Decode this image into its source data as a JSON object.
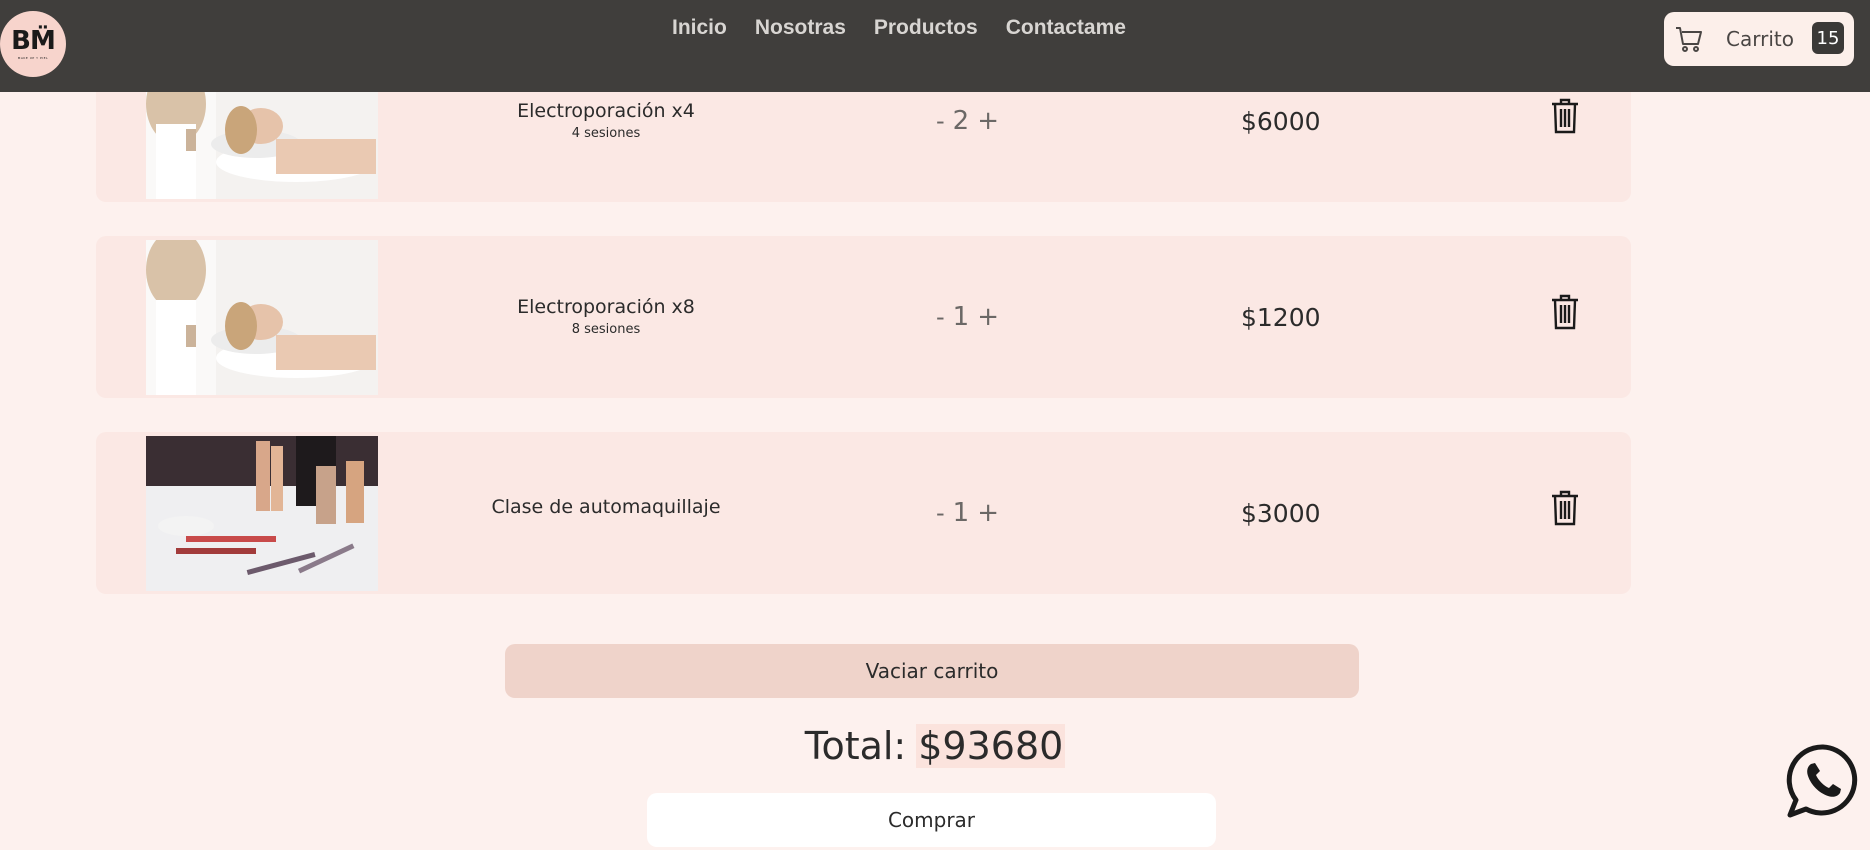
{
  "navbar": {
    "logo": {
      "mark": "BM̈",
      "sub": "MAKE UP Y PIEL"
    },
    "links": [
      "Inicio",
      "Nosotras",
      "Productos",
      "Contactame"
    ],
    "cart": {
      "label": "Carrito",
      "count": "15",
      "icon": "cart-icon"
    }
  },
  "cart": {
    "items": [
      {
        "name": "Electroporación x4",
        "subtitle": "4 sesiones",
        "qty_minus": "-",
        "quantity": "2",
        "qty_plus": "+",
        "price": "$6000",
        "image": "spa-treatment-photo"
      },
      {
        "name": "Electroporación x8",
        "subtitle": "8 sesiones",
        "qty_minus": "-",
        "quantity": "1",
        "qty_plus": "+",
        "price": "$1200",
        "image": "spa-treatment-photo"
      },
      {
        "name": "Clase de automaquillaje",
        "subtitle": "",
        "qty_minus": "-",
        "quantity": "1",
        "qty_plus": "+",
        "price": "$3000",
        "image": "makeup-products-photo"
      }
    ],
    "delete_icon": "trash-icon"
  },
  "actions": {
    "clear_label": "Vaciar carrito",
    "total_label": "Total:",
    "total_value": "$93680",
    "buy_label": "Comprar"
  },
  "floating": {
    "icon": "whatsapp-icon"
  },
  "colors": {
    "page_bg": "#fdf1ee",
    "navbar_bg": "#403e3c",
    "card_bg": "#fbe8e4",
    "clear_button_bg": "#efd3ca",
    "logo_bg": "#f7d4cc"
  }
}
